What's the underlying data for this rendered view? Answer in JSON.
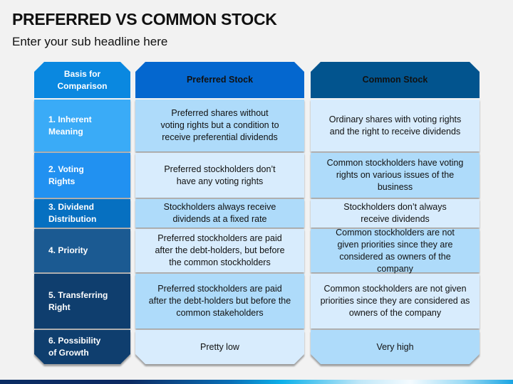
{
  "header": {
    "title": "PREFERRED VS COMMON STOCK",
    "subtitle": "Enter your sub headline here"
  },
  "table": {
    "columns": [
      "Basis for Comparison",
      "Preferred Stock",
      "Common Stock"
    ],
    "rows": [
      {
        "basis": "1. Inherent Meaning",
        "preferred": "Preferred shares without voting rights but a condition to receive preferential dividends",
        "common": "Ordinary shares with voting rights and the right to receive dividends"
      },
      {
        "basis": "2. Voting Rights",
        "preferred": "Preferred stockholders don’t have any voting rights",
        "common": "Common stockholders have voting rights on various issues of the business"
      },
      {
        "basis": "3. Dividend Distribution",
        "preferred": "Stockholders always receive dividends at a fixed rate",
        "common": "Stockholders don’t always receive dividends"
      },
      {
        "basis": "4. Priority",
        "preferred": "Preferred stockholders are paid after the debt-holders, but before the common stockholders",
        "common": "Common stockholders are not given priorities since they are considered as owners of the company"
      },
      {
        "basis": "5. Transferring Right",
        "preferred": "Preferred stockholders are paid after the debt-holders but before the common stakeholders",
        "common": "Common stockholders are not given priorities since they are considered as owners of the company"
      },
      {
        "basis": "6. Possibility of Growth",
        "preferred": "Pretty low",
        "common": "Very high"
      }
    ]
  },
  "colors": {
    "basis_header": "#0a88e0",
    "preferred_header": "#0467cf",
    "common_header": "#02548e",
    "cell_light": "#d8ecfd",
    "cell_dark": "#aedbfa"
  }
}
